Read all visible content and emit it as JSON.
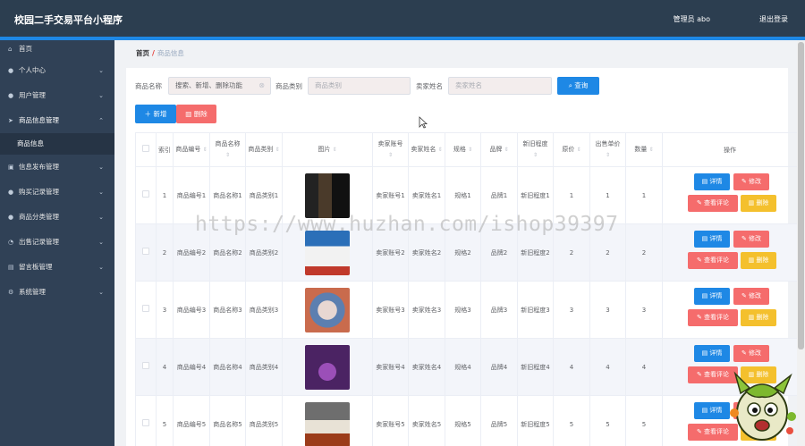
{
  "app": {
    "title": "校园二手交易平台小程序",
    "user": "管理员 abo",
    "logout": "退出登录"
  },
  "sidebar": {
    "home": "首页",
    "items": [
      {
        "label": "个人中心"
      },
      {
        "label": "用户管理"
      },
      {
        "label": "商品信息管理"
      },
      {
        "label": "信息发布管理"
      },
      {
        "label": "购买记录管理"
      },
      {
        "label": "商品分类管理"
      },
      {
        "label": "出售记录管理"
      },
      {
        "label": "留言板管理"
      },
      {
        "label": "系统管理"
      }
    ],
    "subitem": "商品信息"
  },
  "breadcrumb": {
    "home": "首页",
    "current": "商品信息"
  },
  "search": {
    "name_label": "商品名称",
    "name_value": "搜索、新增、删除功能",
    "category_label": "商品类别",
    "category_placeholder": "商品类别",
    "seller_label": "卖家姓名",
    "seller_placeholder": "卖家姓名",
    "query_button": "查询"
  },
  "toolbar": {
    "add": "新增",
    "delete": "删除"
  },
  "table": {
    "headers": [
      "索引",
      "商品编号",
      "商品名称",
      "商品类别",
      "图片",
      "卖家账号",
      "卖家姓名",
      "规格",
      "品牌",
      "新旧程度",
      "原价",
      "出售单价",
      "数量",
      "操作"
    ],
    "rows": [
      {
        "index": "1",
        "code": "商品编号1",
        "name": "商品名称1",
        "category": "商品类别1",
        "account": "卖家账号1",
        "seller": "卖家姓名1",
        "spec": "规格1",
        "brand": "品牌1",
        "condition": "新旧程度1",
        "price": "1",
        "sale": "1",
        "qty": "1"
      },
      {
        "index": "2",
        "code": "商品编号2",
        "name": "商品名称2",
        "category": "商品类别2",
        "account": "卖家账号2",
        "seller": "卖家姓名2",
        "spec": "规格2",
        "brand": "品牌2",
        "condition": "新旧程度2",
        "price": "2",
        "sale": "2",
        "qty": "2"
      },
      {
        "index": "3",
        "code": "商品编号3",
        "name": "商品名称3",
        "category": "商品类别3",
        "account": "卖家账号3",
        "seller": "卖家姓名3",
        "spec": "规格3",
        "brand": "品牌3",
        "condition": "新旧程度3",
        "price": "3",
        "sale": "3",
        "qty": "3"
      },
      {
        "index": "4",
        "code": "商品编号4",
        "name": "商品名称4",
        "category": "商品类别4",
        "account": "卖家账号4",
        "seller": "卖家姓名4",
        "spec": "规格4",
        "brand": "品牌4",
        "condition": "新旧程度4",
        "price": "4",
        "sale": "4",
        "qty": "4"
      },
      {
        "index": "5",
        "code": "商品编号5",
        "name": "商品名称5",
        "category": "商品类别5",
        "account": "卖家账号5",
        "seller": "卖家姓名5",
        "spec": "规格5",
        "brand": "品牌5",
        "condition": "新旧程度5",
        "price": "5",
        "sale": "5",
        "qty": "5"
      }
    ],
    "ops": {
      "detail": "详情",
      "edit": "修改",
      "reviews": "查看评论",
      "delete": "删除"
    }
  },
  "watermark": "https://www.huzhan.com/ishop39397",
  "colors": {
    "topbar": "#2c3e50",
    "sidebar": "#304156",
    "primary": "#1e88e5",
    "danger": "#f56c6c",
    "warning": "#f4c02d"
  }
}
